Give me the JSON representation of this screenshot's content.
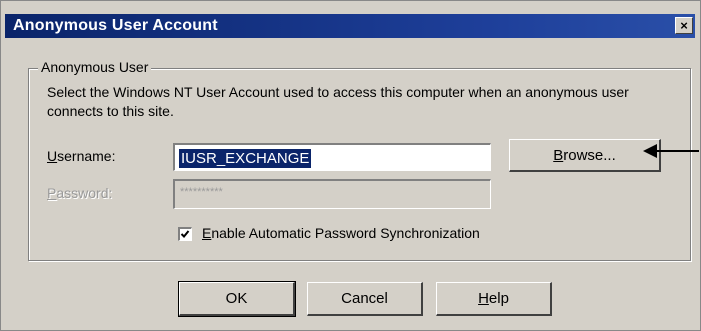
{
  "window": {
    "title": "Anonymous User Account",
    "close_glyph": "×"
  },
  "group": {
    "label": "Anonymous User",
    "description": "Select the Windows NT User Account used to access this computer when an anonymous user connects to this site."
  },
  "username": {
    "label_first": "U",
    "label_rest": "sername:",
    "value": "IUSR_EXCHANGE"
  },
  "password": {
    "label_first": "P",
    "label_rest": "assword:",
    "value": "**********",
    "enabled": false
  },
  "browse_button": {
    "label_first": "B",
    "label_rest": "rowse..."
  },
  "sync_checkbox": {
    "checked": true,
    "label_first": "E",
    "label_rest": "nable Automatic Password Synchronization"
  },
  "buttons": {
    "ok": "OK",
    "cancel": "Cancel",
    "help_first": "H",
    "help_rest": "elp"
  },
  "annotation": {
    "arrow_icon": "left-arrow-icon"
  },
  "colors": {
    "titlebar": "#0a246a",
    "dialog_bg": "#d4d0c8",
    "selection": "#0a246a"
  }
}
